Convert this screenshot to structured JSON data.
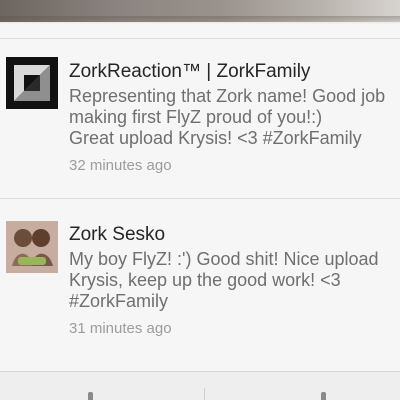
{
  "comments": [
    {
      "author": "ZorkReaction™ | ZorkFamily",
      "text_lines": [
        "Representing that Zork name! Good job",
        "making first FlyZ proud of you!:)",
        "Great upload Krysis! <3 #ZorkFamily"
      ],
      "time": "32 minutes ago",
      "avatar": "zork-logo-icon"
    },
    {
      "author": "Zork Sesko",
      "text_lines": [
        "My boy FlyZ! :') Good shit! Nice upload",
        "Krysis, keep up the good work! <3",
        "#ZorkFamily"
      ],
      "time": "31 minutes ago",
      "avatar": "user-avatar-photo"
    }
  ],
  "bottom_bar": {
    "left_icon": "comment-action-icon",
    "right_icon": "menu-action-icon"
  },
  "colors": {
    "background": "#f6f6f6",
    "author": "#252525",
    "body_text": "#6f6f6f",
    "timestamp": "#9c9c9c",
    "separator": "#dcdcdc"
  }
}
